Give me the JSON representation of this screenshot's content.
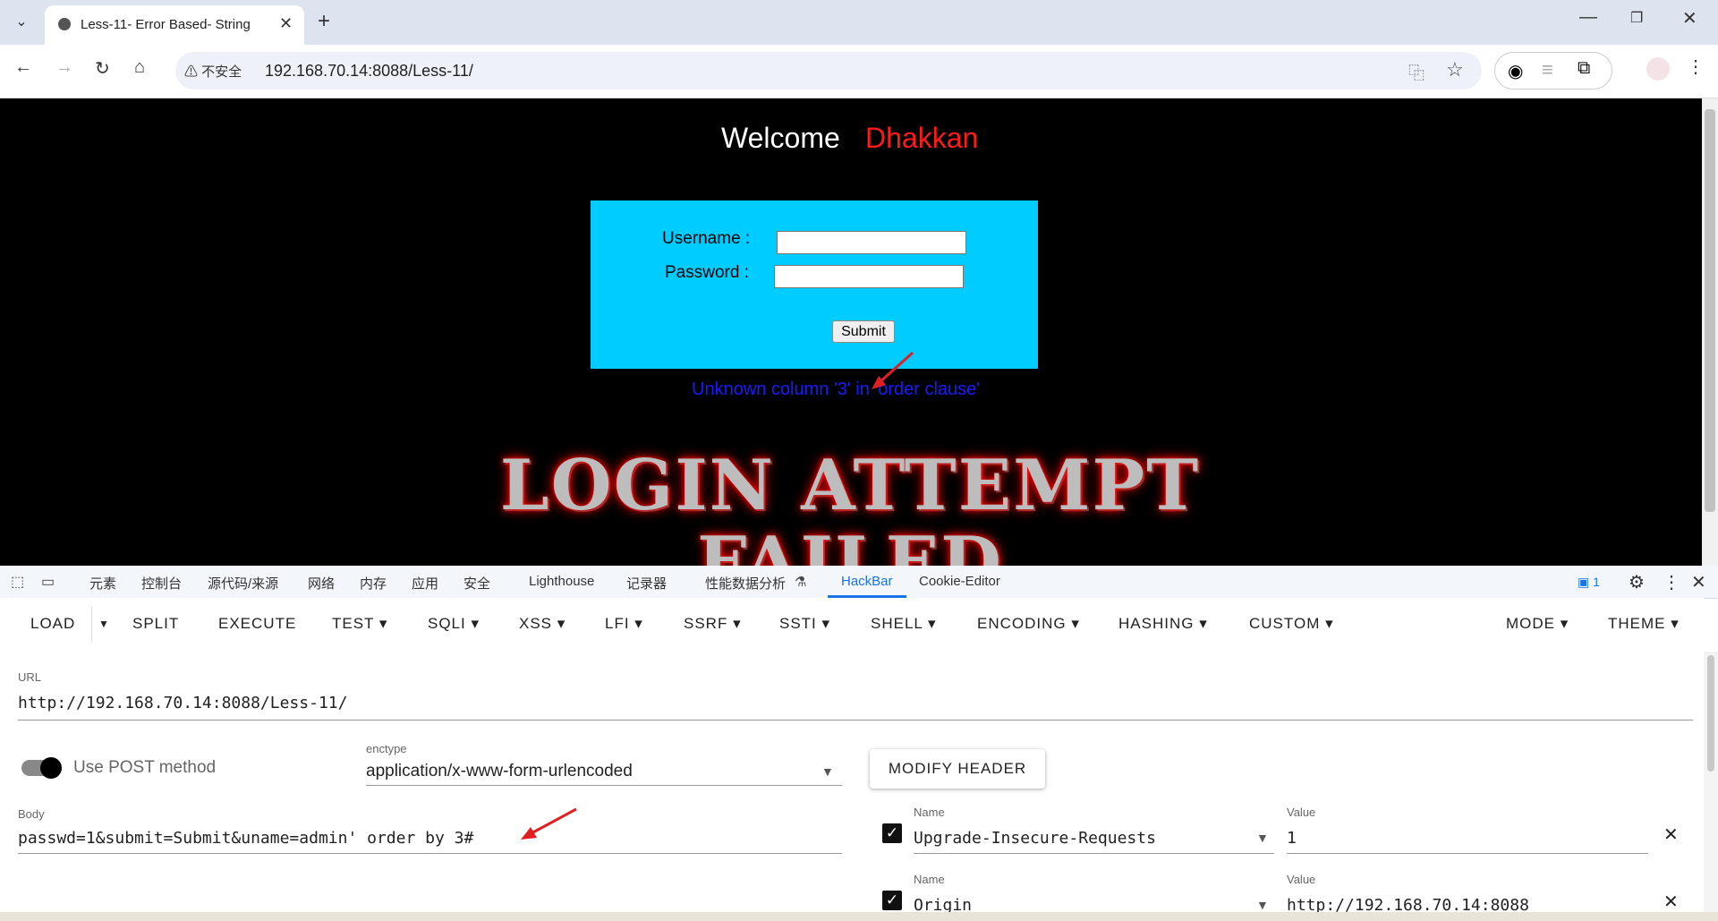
{
  "browser": {
    "tab_title": "Less-11- Error Based- String",
    "security_label": "不安全",
    "url": "192.168.70.14:8088/Less-11/"
  },
  "page": {
    "welcome": "Welcome",
    "name": "Dhakkan",
    "username_label": "Username :",
    "password_label": "Password :",
    "submit_label": "Submit",
    "error_message": "Unknown column '3' in 'order clause'",
    "banner_line1": "LOGIN ATTEMPT",
    "banner_line2": "FAILED"
  },
  "devtools": {
    "tabs": [
      "元素",
      "控制台",
      "源代码/来源",
      "网络",
      "内存",
      "应用",
      "安全",
      "Lighthouse",
      "记录器",
      "性能数据分析",
      "HackBar",
      "Cookie-Editor"
    ],
    "active_tab": "HackBar",
    "message_count": "1"
  },
  "hackbar": {
    "toolbar": [
      "LOAD",
      "SPLIT",
      "EXECUTE",
      "TEST",
      "SQLI",
      "XSS",
      "LFI",
      "SSRF",
      "SSTI",
      "SHELL",
      "ENCODING",
      "HASHING",
      "CUSTOM",
      "MODE",
      "THEME"
    ],
    "url_label": "URL",
    "url_value": "http://192.168.70.14:8088/Less-11/",
    "post_toggle_label": "Use POST method",
    "post_enabled": true,
    "enctype_label": "enctype",
    "enctype_value": "application/x-www-form-urlencoded",
    "modify_header_label": "MODIFY HEADER",
    "body_label": "Body",
    "body_value": "passwd=1&submit=Submit&uname=admin' order by 3#",
    "headers": [
      {
        "name_label": "Name",
        "name": "Upgrade-Insecure-Requests",
        "value_label": "Value",
        "value": "1",
        "enabled": true
      },
      {
        "name_label": "Name",
        "name": "Origin",
        "value_label": "Value",
        "value": "http://192.168.70.14:8088",
        "enabled": true
      }
    ]
  },
  "colors": {
    "login_box": "#00ccff",
    "dhakkan": "#ff1a1a",
    "error_text": "#1a1aff",
    "accent": "#1a73e8"
  }
}
